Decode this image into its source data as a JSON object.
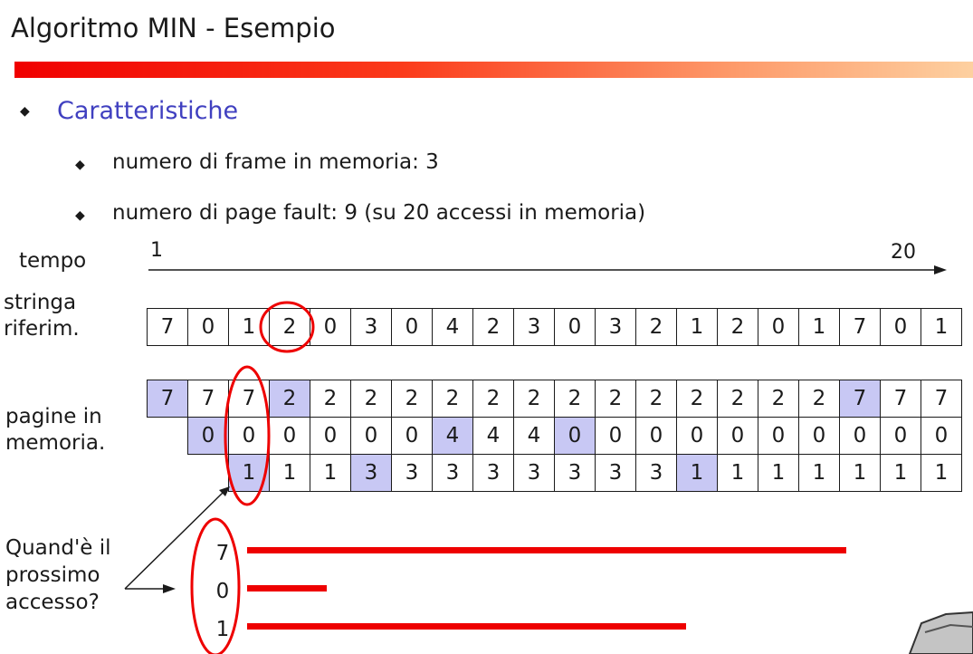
{
  "title": "Algoritmo MIN - Esempio",
  "bullets": {
    "main": "Caratteristiche",
    "sub1": "numero di frame in memoria: 3",
    "sub2": "numero di page fault: 9 (su 20 accessi in memoria)"
  },
  "labels": {
    "tempo": "tempo",
    "time_start": "1",
    "time_end": "20",
    "stringa_line1": "stringa",
    "stringa_line2": "riferim.",
    "pagine_line1": "pagine in",
    "pagine_line2": "memoria.",
    "quand_line1": "Quand'è il",
    "quand_line2": "prossimo",
    "quand_line3": "accesso?"
  },
  "reference_string": [
    "7",
    "0",
    "1",
    "2",
    "0",
    "3",
    "0",
    "4",
    "2",
    "3",
    "0",
    "3",
    "2",
    "1",
    "2",
    "0",
    "1",
    "7",
    "0",
    "1"
  ],
  "memory_frames": [
    [
      "7",
      "7",
      "7",
      "2",
      "2",
      "2",
      "2",
      "2",
      "2",
      "2",
      "2",
      "2",
      "2",
      "2",
      "2",
      "2",
      "2",
      "7",
      "7",
      "7"
    ],
    [
      "",
      "0",
      "0",
      "0",
      "0",
      "0",
      "0",
      "4",
      "4",
      "4",
      "0",
      "0",
      "0",
      "0",
      "0",
      "0",
      "0",
      "0",
      "0",
      "0"
    ],
    [
      "",
      "",
      "1",
      "1",
      "1",
      "3",
      "3",
      "3",
      "3",
      "3",
      "3",
      "3",
      "3",
      "1",
      "1",
      "1",
      "1",
      "1",
      "1",
      "1"
    ]
  ],
  "page_faults": [
    {
      "frame": 0,
      "time": 1
    },
    {
      "frame": 0,
      "time": 4
    },
    {
      "frame": 0,
      "time": 18
    },
    {
      "frame": 1,
      "time": 2
    },
    {
      "frame": 1,
      "time": 8
    },
    {
      "frame": 1,
      "time": 11
    },
    {
      "frame": 2,
      "time": 3
    },
    {
      "frame": 2,
      "time": 6
    },
    {
      "frame": 2,
      "time": 14
    }
  ],
  "next_access": [
    {
      "page": "7",
      "next_time": 18
    },
    {
      "page": "0",
      "next_time": 5
    },
    {
      "page": "1",
      "next_time": 14
    }
  ],
  "colors": {
    "fault_highlight": "#c8c8f4",
    "annotation_red": "#ee0000",
    "main_bullet_text": "#4040c0"
  }
}
